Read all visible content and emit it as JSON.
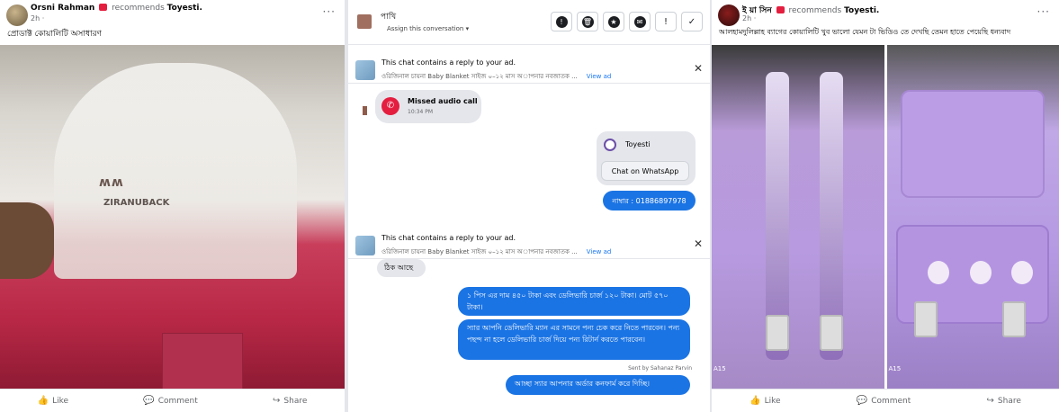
{
  "left_post": {
    "author": "Orsni Rahman",
    "recommends": "recommends",
    "page": "Toyesti.",
    "time": "2h ·",
    "dots": "···",
    "text": "প্রোডাক্ট কোয়ালিটি অসাধারণ",
    "bag_logo": "ʍʍ",
    "bag_brand": "ZIRANUBACK",
    "actions": {
      "like": "Like",
      "comment": "Comment",
      "share": "Share"
    }
  },
  "chat": {
    "contact_name": "পাখি",
    "assign": "Assign this conversation",
    "ad_reply_1": {
      "title": "This chat contains a reply to your ad.",
      "sub": "ওরিজিনাল চায়না Baby Blanket সাইজ ০–১২ মাস অাপনার নবজাতক ...",
      "link": "View ad"
    },
    "missed_call": {
      "title": "Missed audio call",
      "time": "10:34 PM"
    },
    "whatsapp_card": {
      "name": "Toyesti",
      "button": "Chat on WhatsApp"
    },
    "number_msg": "নাম্বার : 01886897978",
    "ad_reply_2": {
      "title": "This chat contains a reply to your ad.",
      "sub": "ওরিজিনাল চায়না Baby Blanket সাইজ ০–১২ মাস অাপনার নবজাতক ...",
      "link": "View ad"
    },
    "reply_in": "ঠিক আছে",
    "msg1": "১ পিস এর দাম ৪৫০ টাকা এবং ডেলিভারি চার্জ ১২০ টাকা। মোট ৫৭০ টাকা।",
    "msg2": "স্যার আপনি ডেলিভারি ম্যান এর সামনে পন্য চেক করে নিতে পারবেন। পন্য পছন্দ না হলে ডেলিভারি চার্জ দিয়ে পন্য রিটার্ন করতে পারবেন।",
    "sent_by": "Sent by Sahanaz Parvin",
    "msg3": "আচ্ছা স্যার আপনার অর্ডার কনফার্ম করে দিচ্ছি।"
  },
  "right_post": {
    "author": "ই য়া সিন",
    "recommends": "recommends",
    "page": "Toyesti.",
    "time": "2h ·",
    "dots": "···",
    "text": "আলহামদুলিল্লাহ ব্যাগের কোয়ালিটি খুব ভালো যেমন টা ভিডিও তে দেখছি তেমন হাতে পেয়েছি ধন্যবাদ",
    "watermark_left": "A15",
    "watermark_right": "A15",
    "actions": {
      "like": "Like",
      "comment": "Comment",
      "share": "Share"
    }
  },
  "colors": {
    "messenger_blue": "#1b74e4",
    "missed_red": "#e41e3f",
    "link_blue": "#1877f2"
  }
}
